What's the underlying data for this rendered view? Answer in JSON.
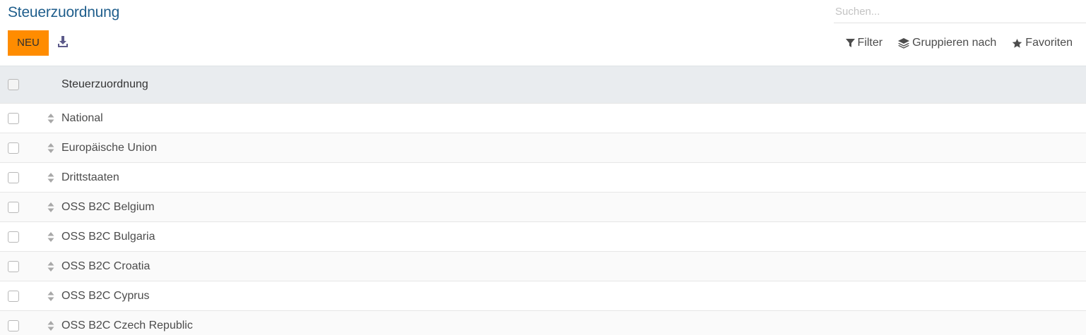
{
  "header": {
    "title": "Steuerzuordnung",
    "search_placeholder": "Suchen..."
  },
  "toolbar": {
    "new_label": "NEU",
    "download_icon": "download-icon"
  },
  "search_panel": {
    "filter_label": "Filter",
    "group_by_label": "Gruppieren nach",
    "favorites_label": "Favoriten"
  },
  "table": {
    "column_header": "Steuerzuordnung",
    "rows": [
      "National",
      "Europäische Union",
      "Drittstaaten",
      "OSS B2C Belgium",
      "OSS B2C Bulgaria",
      "OSS B2C Croatia",
      "OSS B2C Cyprus",
      "OSS B2C Czech Republic"
    ]
  },
  "colors": {
    "title": "#1f5e8c",
    "primary_button": "#ff8c00",
    "header_bg": "#e9ecef",
    "icon": "#5c5a8a"
  }
}
